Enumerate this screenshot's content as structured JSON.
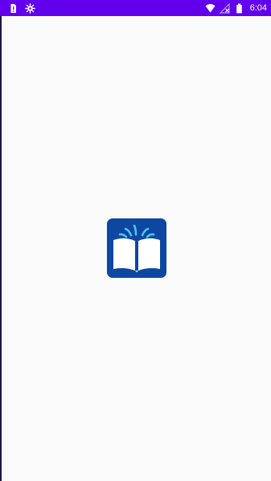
{
  "status_bar": {
    "time": "6:04",
    "background_color": "#6200ee",
    "left_icons": [
      "sim-card-alert-icon",
      "bug-icon"
    ],
    "right_icons": [
      "wifi-icon",
      "no-signal-icon",
      "battery-icon"
    ]
  },
  "splash": {
    "background_color": "#fafafa",
    "logo_icon": "open-book-icon",
    "logo_background_color": "#0d47a1"
  }
}
